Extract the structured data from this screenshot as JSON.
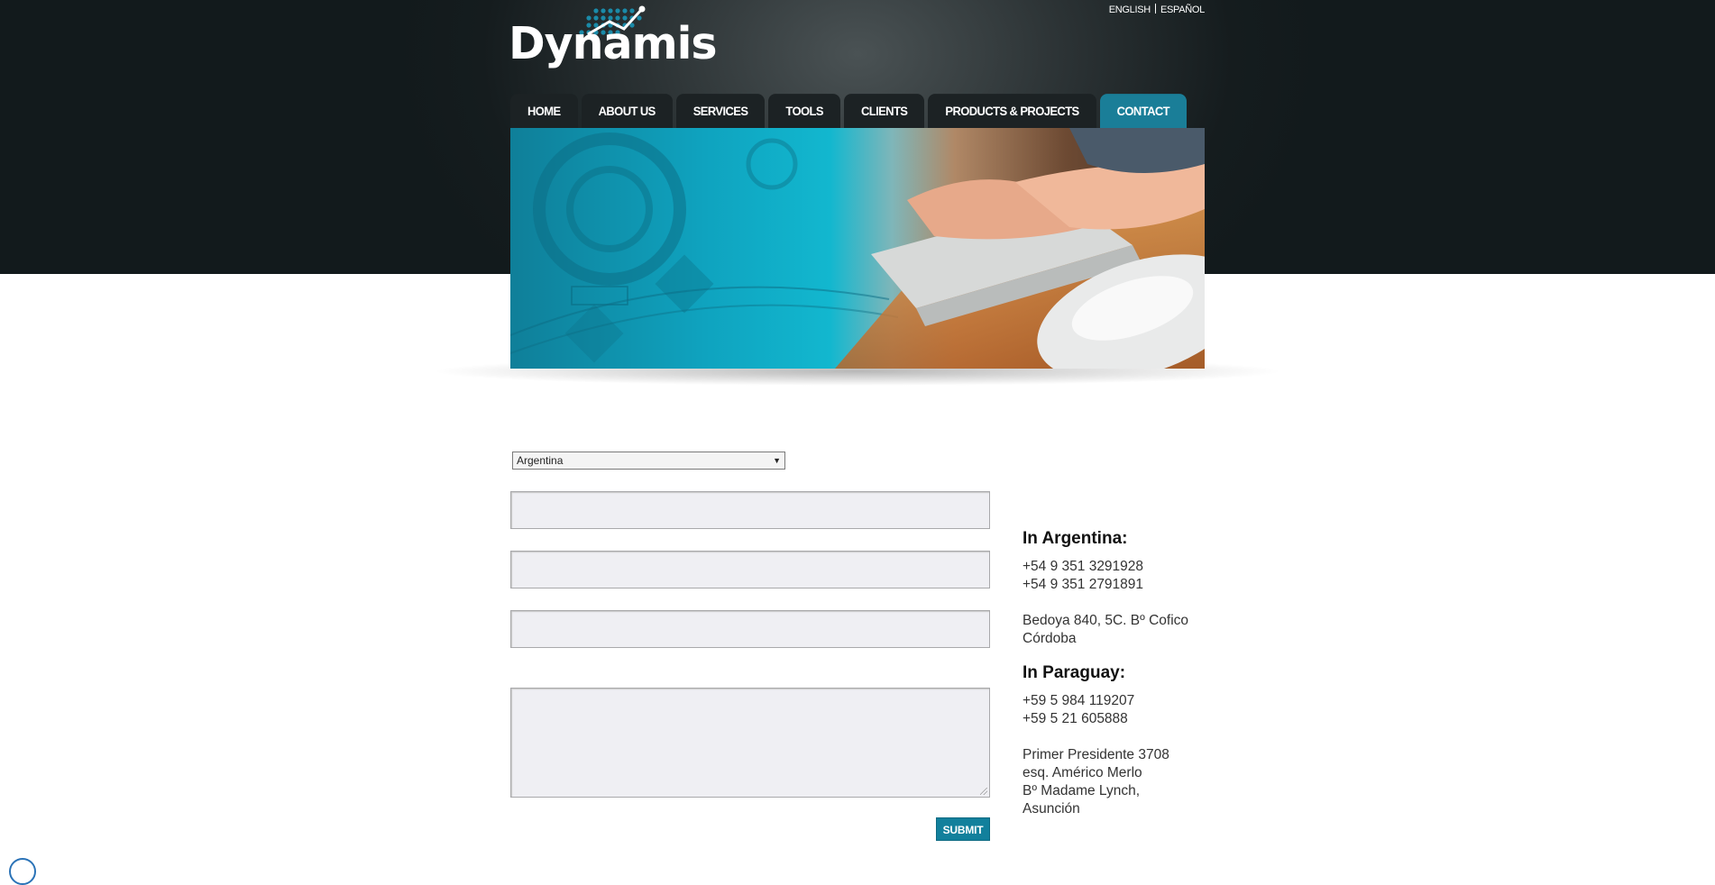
{
  "brand": {
    "name": "Dynamis"
  },
  "language": {
    "english": "ENGLISH",
    "spanish": "ESPAÑOL"
  },
  "nav": {
    "items": [
      {
        "label": "HOME"
      },
      {
        "label": "ABOUT US"
      },
      {
        "label": "SERVICES"
      },
      {
        "label": "TOOLS"
      },
      {
        "label": "CLIENTS"
      },
      {
        "label": "PRODUCTS & PROJECTS"
      },
      {
        "label": "CONTACT"
      }
    ],
    "active": "CONTACT"
  },
  "form": {
    "country_value": "Argentina",
    "submit_label": "SUBMIT"
  },
  "contact": {
    "argentina": {
      "heading": "In Argentina:",
      "phone1": "+54 9 351 3291928",
      "phone2": "+54 9 351 2791891",
      "address1": "Bedoya 840, 5C. Bº Cofico",
      "address2": "Córdoba"
    },
    "paraguay": {
      "heading": "In Paraguay:",
      "phone1": "+59 5 984 119207",
      "phone2": "+59 5 21 605888",
      "address1": "Primer Presidente 3708",
      "address2": "esq. Américo Merlo",
      "address3": "Bº Madame Lynch,",
      "address4": "Asunción"
    }
  },
  "colors": {
    "accent": "#1a7e98",
    "header_bg": "#1b2224"
  }
}
